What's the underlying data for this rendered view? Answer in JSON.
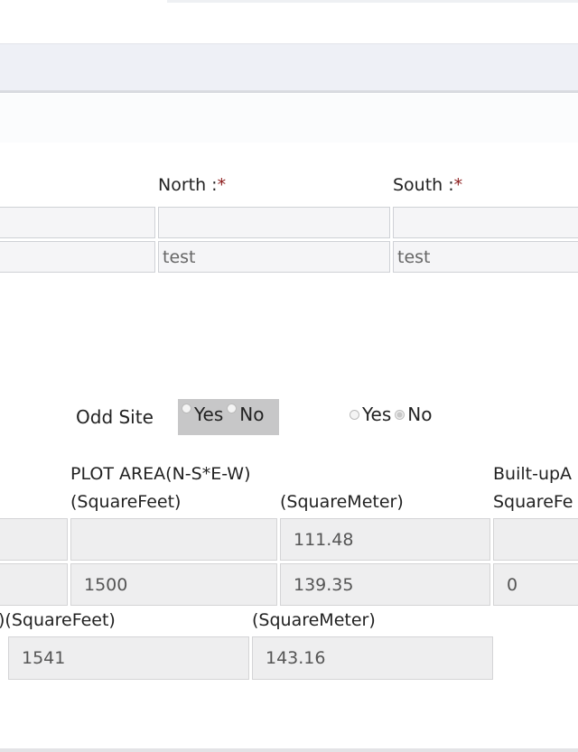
{
  "boundaries": {
    "north_label": "North :",
    "south_label": "South :",
    "required_mark": "*",
    "row1": {
      "left": "",
      "north": "",
      "south": ""
    },
    "row2": {
      "left": "",
      "north": "test",
      "south": "test"
    }
  },
  "odd_site": {
    "label": "Odd Site",
    "group1": {
      "yes": "Yes",
      "no": "No",
      "selected": "none"
    },
    "group2": {
      "yes": "Yes",
      "no": "No",
      "selected": "No"
    }
  },
  "area": {
    "plot_area_label": "PLOT AREA(N-S*E-W)",
    "sqft_label": "(SquareFeet)",
    "sqm_label": "(SquareMeter)",
    "builtup_label": "Built-upA",
    "builtup_sqft_label": "SquareFe",
    "row1": {
      "left": "",
      "sqft": "",
      "sqm": "111.48",
      "builtup": ""
    },
    "row2": {
      "left": "",
      "sqft": "1500",
      "sqm": "139.35",
      "builtup": "0"
    }
  },
  "total": {
    "sqft_label": ")(SquareFeet)",
    "sqm_label": "(SquareMeter)",
    "sqft": "1541",
    "sqm": "143.16"
  }
}
